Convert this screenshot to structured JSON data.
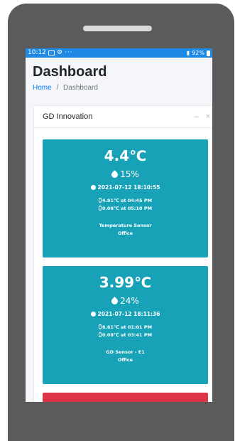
{
  "statusbar": {
    "time": "10:12",
    "battery": "92%"
  },
  "page": {
    "title": "Dashboard",
    "breadcrumb_home": "Home",
    "breadcrumb_sep": "/",
    "breadcrumb_current": "Dashboard"
  },
  "card": {
    "title": "GD Innovation",
    "minimize": "–",
    "close": "×"
  },
  "sensors": [
    {
      "temperature": "4.4℃",
      "humidity": "15%",
      "timestamp": "2021-07-12 18:10:55",
      "max_reading": "4.91℃ at 04:45 PM",
      "min_reading": "0.06℃ at 05:10 PM",
      "name": "Temperature Sensor",
      "location": "Office"
    },
    {
      "temperature": "3.99℃",
      "humidity": "24%",
      "timestamp": "2021-07-12 18:11:36",
      "max_reading": "6.61℃ at 01:01 PM",
      "min_reading": "0.08℃ at 03:41 PM",
      "name": "GD Sensor - E1",
      "location": "Office"
    }
  ],
  "colors": {
    "statusbar": "#1e88e5",
    "card_info": "#17a2b8",
    "card_danger": "#dc3545",
    "link": "#007bff"
  }
}
